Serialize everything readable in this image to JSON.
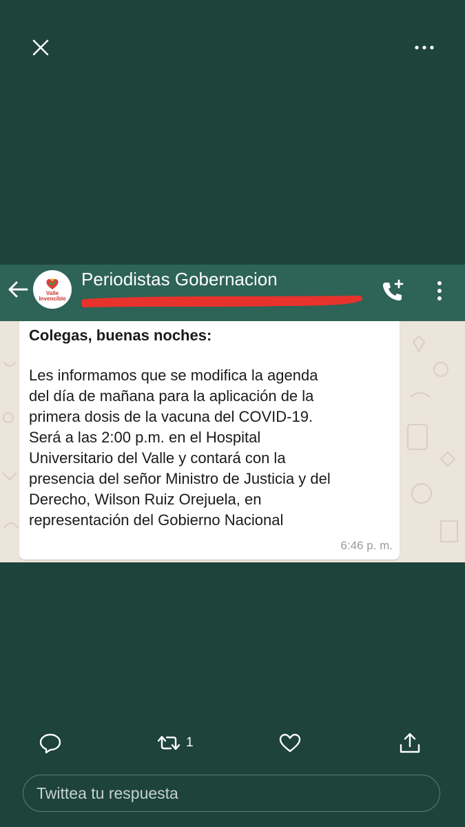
{
  "viewer": {
    "close_icon": "close-icon",
    "more_icon": "more-horizontal-icon"
  },
  "chat_screenshot": {
    "group_name": "Periodistas Gobernacion",
    "avatar_text": [
      "Valle",
      "Invencible"
    ],
    "greeting": "Colegas, buenas noches:",
    "message_lines": [
      "Les informamos que se modifica la agenda",
      "del día de mañana para la aplicación de la",
      "primera dosis de la vacuna del COVID-19.",
      "Será a las 2:00 p.m. en el Hospital",
      "Universitario del Valle y contará con la",
      "presencia del señor Ministro de Justicia y del",
      "Derecho, Wilson Ruiz Orejuela, en",
      "representación del Gobierno Nacional"
    ],
    "time": "6:46 p. m.",
    "colors": {
      "header": "#2e6357",
      "chat_bg": "#ece5dc",
      "redaction": "#e8322c"
    }
  },
  "tweet_actions": {
    "reply_icon": "reply-icon",
    "retweet_icon": "retweet-icon",
    "retweet_count": "1",
    "like_icon": "heart-icon",
    "share_icon": "share-icon"
  },
  "reply_input": {
    "placeholder": "Twittea tu respuesta"
  },
  "colors": {
    "background": "#1d433b"
  }
}
